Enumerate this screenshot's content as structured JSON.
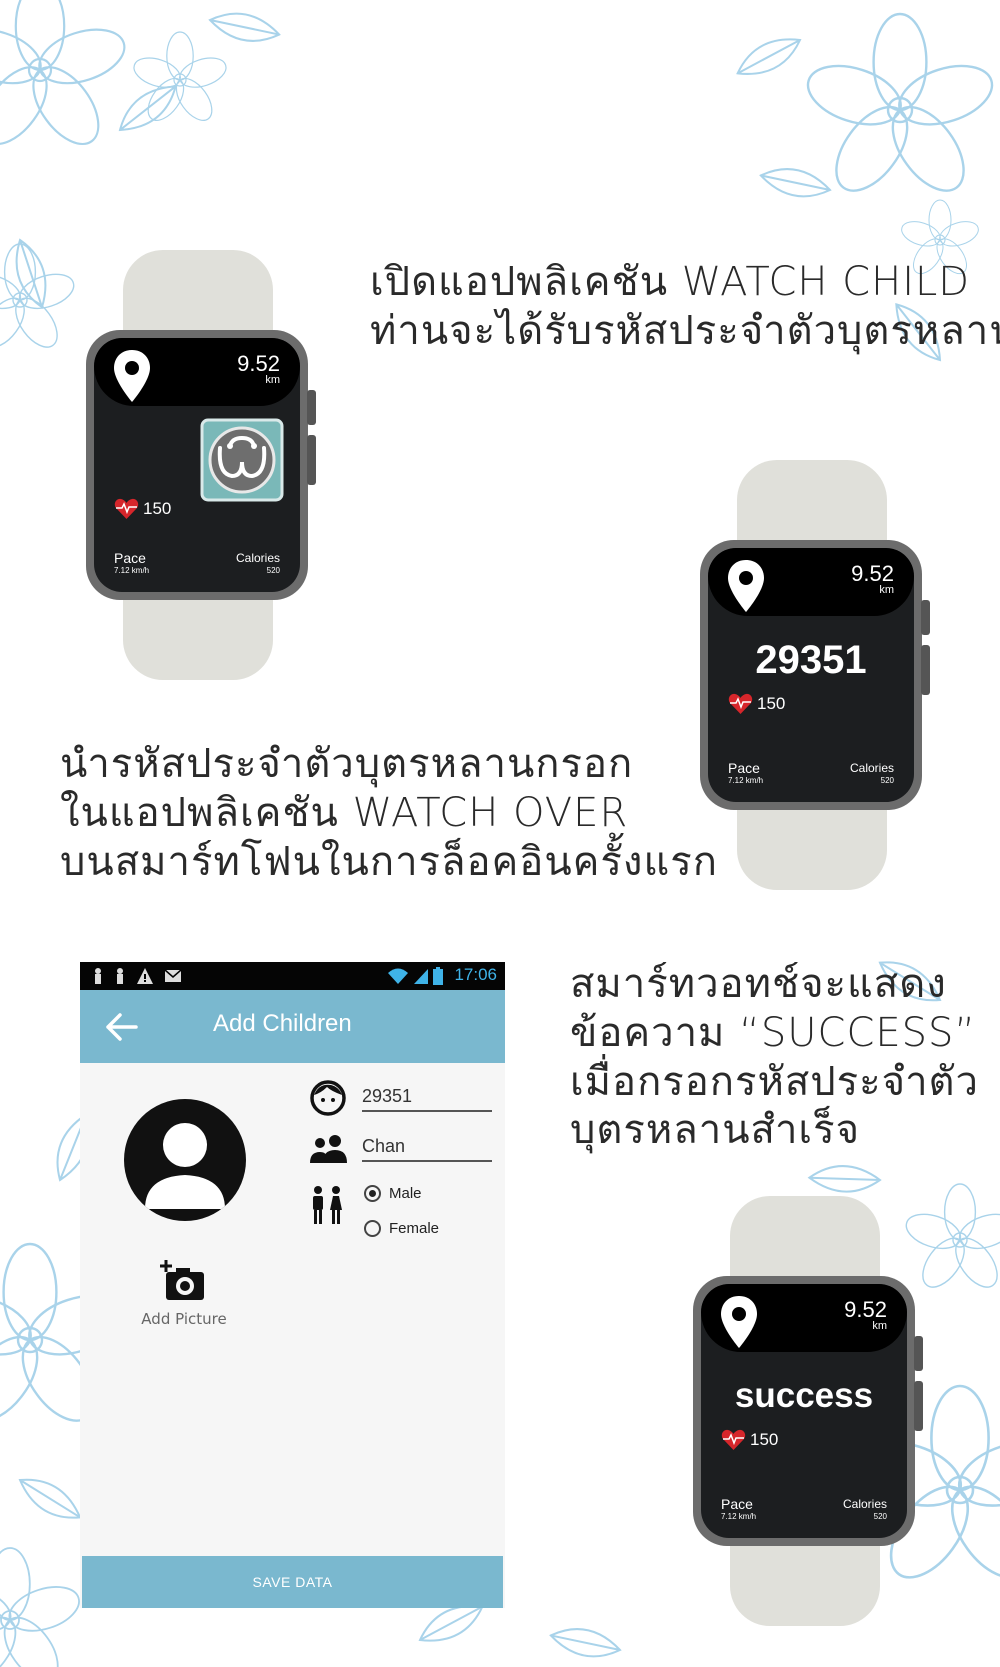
{
  "captions": {
    "step1": [
      "เปิดแอปพลิเคชัน WATCH CHILD",
      "ท่านจะได้รับรหัสประจำตัวบุตรหลาน"
    ],
    "step2": [
      "นำรหัสประจำตัวบุตรหลานกรอก",
      "ในแอปพลิเคชัน WATCH OVER",
      "บนสมาร์ทโฟนในการล็อคอินครั้งแรก"
    ],
    "step3": [
      "สมาร์ทวอทช์จะแสดง",
      "ข้อความ “SUCCESS”",
      "เมื่อกรอกรหัสประจำตัว",
      "บุตรหลานสำเร็จ"
    ]
  },
  "watch_stats": {
    "distance": "9.52",
    "distance_unit": "km",
    "heart_rate": "150",
    "pace_label": "Pace",
    "pace_value": "7.12 km/h",
    "calories_label": "Calories",
    "calories_value": "520"
  },
  "watch2": {
    "code": "29351"
  },
  "watch3": {
    "message": "success"
  },
  "phone": {
    "status_time": "17:06",
    "title": "Add Children",
    "add_picture_label": "Add Picture",
    "code_value": "29351",
    "name_value": "Chan",
    "gender_options": [
      "Male",
      "Female"
    ],
    "gender_selected": "Male",
    "save_label": "SAVE DATA"
  },
  "colors": {
    "accent": "#7ab8cf",
    "watch_screen": "#1c1e20",
    "watch_strap": "#e0e0da",
    "watch_case": "#6c6c6c",
    "heart": "#d6262b",
    "floral": "#a9d3ea"
  }
}
